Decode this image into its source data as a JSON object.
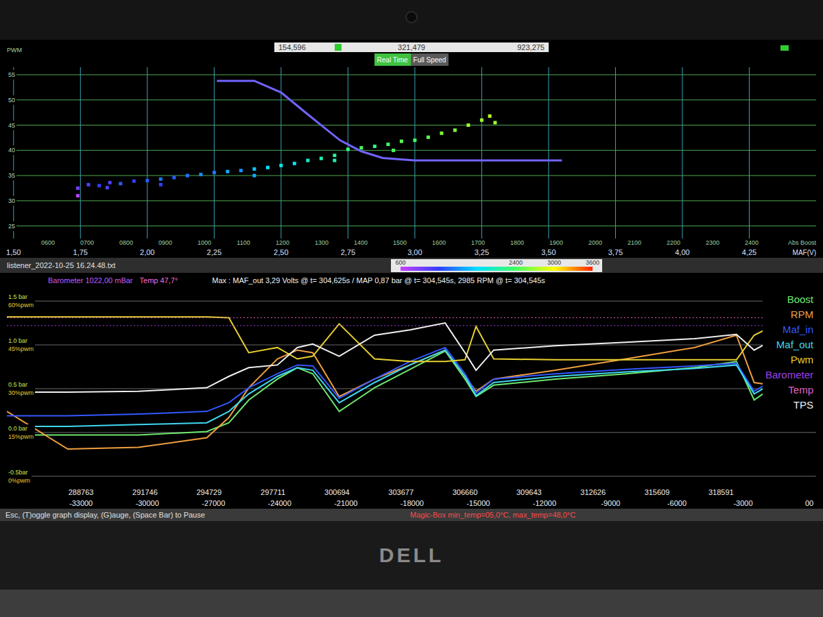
{
  "brand": "DELL",
  "top_chart": {
    "axis_title": "PWM",
    "range_bar": {
      "start": "154,596",
      "current": "321,479",
      "end": "923,275",
      "level": 0.22
    },
    "mode_buttons": [
      {
        "label": "Real Time",
        "selected": true
      },
      {
        "label": "Full Speed",
        "selected": false
      }
    ],
    "indicator": {
      "on": true
    },
    "y_ticks": [
      "55",
      "50",
      "45",
      "40",
      "35",
      "30",
      "25"
    ],
    "rpm_ticks": [
      "0600",
      "0700",
      "0800",
      "0900",
      "1000",
      "1100",
      "1200",
      "1300",
      "1400",
      "1500",
      "1600",
      "1700",
      "1800",
      "1900",
      "2000",
      "2100",
      "2200",
      "2300",
      "2400"
    ],
    "rpm_axis_title": "Abs Boost",
    "maf_ticks": [
      "1,50",
      "1,75",
      "2,00",
      "2,25",
      "2,50",
      "2,75",
      "3,00",
      "3,25",
      "3,50",
      "3,75",
      "4,00",
      "4,25"
    ],
    "maf_axis_title": "MAF(V)",
    "scatter": [
      [
        1.74,
        31.0,
        650
      ],
      [
        1.74,
        32.5,
        900
      ],
      [
        1.78,
        33.2,
        1000
      ],
      [
        1.82,
        33.0,
        1100
      ],
      [
        1.86,
        33.6,
        1000
      ],
      [
        1.9,
        33.4,
        1200
      ],
      [
        1.95,
        33.9,
        1100
      ],
      [
        2.0,
        34.0,
        1200
      ],
      [
        2.05,
        34.3,
        1300
      ],
      [
        2.1,
        34.6,
        1200
      ],
      [
        2.15,
        35.0,
        1300
      ],
      [
        2.2,
        35.2,
        1400
      ],
      [
        2.25,
        35.6,
        1300
      ],
      [
        2.3,
        35.8,
        1500
      ],
      [
        2.35,
        36.0,
        1400
      ],
      [
        2.4,
        36.3,
        1600
      ],
      [
        2.45,
        36.6,
        1700
      ],
      [
        2.5,
        37.0,
        1800
      ],
      [
        2.55,
        37.4,
        1700
      ],
      [
        2.6,
        38.0,
        1900
      ],
      [
        2.65,
        38.4,
        2000
      ],
      [
        2.7,
        39.0,
        2100
      ],
      [
        2.75,
        40.2,
        2200
      ],
      [
        2.8,
        40.5,
        2300
      ],
      [
        2.85,
        40.8,
        2200
      ],
      [
        2.9,
        41.2,
        2300
      ],
      [
        2.95,
        41.8,
        2400
      ],
      [
        3.0,
        42.0,
        2300
      ],
      [
        3.05,
        42.6,
        2400
      ],
      [
        3.1,
        43.4,
        2500
      ],
      [
        3.15,
        44.0,
        2500
      ],
      [
        3.2,
        45.0,
        2600
      ],
      [
        3.25,
        46.0,
        2600
      ],
      [
        3.28,
        46.8,
        2700
      ],
      [
        3.3,
        45.5,
        2600
      ],
      [
        2.92,
        40.0,
        2300
      ],
      [
        2.7,
        38.0,
        2000
      ],
      [
        2.4,
        35.0,
        1500
      ],
      [
        2.05,
        33.2,
        1100
      ],
      [
        1.85,
        32.6,
        1000
      ]
    ],
    "line": [
      [
        2.26,
        53.8
      ],
      [
        2.4,
        53.8
      ],
      [
        2.5,
        51.5
      ],
      [
        2.58,
        48.0
      ],
      [
        2.65,
        45.0
      ],
      [
        2.72,
        42.0
      ],
      [
        2.8,
        39.8
      ],
      [
        2.88,
        38.5
      ],
      [
        3.0,
        38.0
      ],
      [
        3.55,
        38.0
      ]
    ]
  },
  "file_bar": {
    "filename": "listener_2022-10-25 16.24.48.txt"
  },
  "color_scale": {
    "labels": [
      "600",
      "2400",
      "3000",
      "3600"
    ]
  },
  "bottom_chart": {
    "barometer": "Barometer 1022,00 mBar",
    "temp": "Temp 47,7°",
    "max_info": "Max :  MAF_out 3,29 Volts @ t= 304,625s / MAP  0,87 bar @ t= 304,545s, 2985 RPM  @ t= 304,545s",
    "y_ticks": [
      {
        "bar": "1.5 bar",
        "pwm": "60%pwm"
      },
      {
        "bar": "1.0 bar",
        "pwm": "45%pwm"
      },
      {
        "bar": "0.5 bar",
        "pwm": "30%pwm"
      },
      {
        "bar": "0.0 bar",
        "pwm": "15%pwm"
      },
      {
        "bar": "-0.5bar",
        "pwm": "0%pwm"
      }
    ],
    "abs_ticks": [
      "288763",
      "291746",
      "294729",
      "297711",
      "300694",
      "303677",
      "306660",
      "309643",
      "312626",
      "315609",
      "318591"
    ],
    "rel_ticks": [
      "-33000",
      "-30000",
      "-27000",
      "-24000",
      "-21000",
      "-18000",
      "-15000",
      "-12000",
      "-9000",
      "-6000",
      "-3000",
      "00"
    ],
    "time": [
      -36360,
      -33600,
      -30400,
      -27300,
      -26300,
      -25400,
      -24100,
      -23200,
      -22500,
      -21300,
      -19700,
      -18100,
      -16500,
      -15600,
      -15100,
      -14300,
      -11500,
      -8300,
      -5200,
      -3300,
      -2500,
      -1700,
      200
    ],
    "series": [
      {
        "name": "Boost",
        "color": "#6ee86e",
        "kind": "line",
        "values": [
          -0.03,
          -0.03,
          -0.03,
          0.01,
          0.11,
          0.37,
          0.61,
          0.74,
          0.67,
          0.24,
          0.51,
          0.72,
          0.93,
          0.61,
          0.41,
          0.54,
          0.61,
          0.67,
          0.74,
          0.81,
          0.37,
          0.51,
          0.54
        ]
      },
      {
        "name": "RPM",
        "color": "#f0a040",
        "kind": "line",
        "values": [
          0.24,
          -0.19,
          -0.17,
          -0.06,
          0.17,
          0.51,
          0.84,
          0.94,
          0.91,
          0.41,
          0.61,
          0.77,
          0.94,
          0.64,
          0.47,
          0.61,
          0.71,
          0.84,
          0.97,
          1.11,
          0.57,
          0.54,
          0.57
        ]
      },
      {
        "name": "Maf_in",
        "color": "#3358ff",
        "kind": "line",
        "values": [
          0.19,
          0.19,
          0.21,
          0.24,
          0.34,
          0.51,
          0.67,
          0.77,
          0.76,
          0.39,
          0.61,
          0.81,
          0.97,
          0.67,
          0.45,
          0.61,
          0.67,
          0.72,
          0.76,
          0.79,
          0.47,
          0.59,
          0.61
        ]
      },
      {
        "name": "Maf_out",
        "color": "#40d8f0",
        "kind": "line",
        "values": [
          0.07,
          0.07,
          0.09,
          0.11,
          0.24,
          0.44,
          0.64,
          0.74,
          0.71,
          0.34,
          0.57,
          0.77,
          0.94,
          0.64,
          0.42,
          0.57,
          0.64,
          0.69,
          0.73,
          0.77,
          0.44,
          0.56,
          0.57
        ]
      },
      {
        "name": "Pwm",
        "color": "#e8d030",
        "kind": "line",
        "values": [
          1.32,
          1.32,
          1.32,
          1.32,
          1.31,
          0.91,
          0.97,
          0.84,
          0.87,
          1.24,
          0.84,
          0.81,
          0.81,
          0.83,
          1.21,
          0.84,
          0.83,
          0.83,
          0.83,
          0.83,
          1.11,
          1.21,
          0.83
        ]
      },
      {
        "name": "Barometer",
        "color": "#a040e0",
        "kind": "dotted",
        "values": [
          1.22,
          1.22,
          1.22,
          1.22,
          1.22,
          1.22,
          1.22,
          1.22,
          1.22,
          1.22,
          1.22,
          1.22,
          1.22,
          1.22,
          1.22,
          1.22,
          1.22,
          1.22,
          1.22,
          1.22,
          1.22,
          1.22,
          1.22
        ]
      },
      {
        "name": "Temp",
        "color": "#e060c0",
        "kind": "dotted",
        "values": [
          1.31,
          1.31,
          1.31,
          1.31,
          1.31,
          1.31,
          1.31,
          1.31,
          1.31,
          1.31,
          1.31,
          1.31,
          1.31,
          1.31,
          1.31,
          1.31,
          1.31,
          1.31,
          1.31,
          1.31,
          1.31,
          1.31,
          1.31
        ]
      },
      {
        "name": "TPS",
        "color": "#f0f0f0",
        "kind": "line",
        "values": [
          0.46,
          0.46,
          0.47,
          0.51,
          0.64,
          0.74,
          0.77,
          0.97,
          1.01,
          0.87,
          1.11,
          1.17,
          1.25,
          0.91,
          0.71,
          0.94,
          0.99,
          1.03,
          1.07,
          1.12,
          0.94,
          1.05,
          1.05
        ]
      }
    ]
  },
  "status_bar": {
    "help": "Esc, (T)oggle graph display, (G)auge, (Space Bar) to Pause",
    "magic_box": "Magic-Box  min_temp=05,0°C, max_temp=48,0°C"
  }
}
